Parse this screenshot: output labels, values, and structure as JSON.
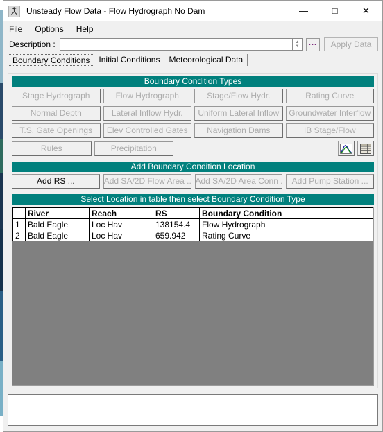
{
  "window": {
    "title": "Unsteady Flow Data - Flow Hydrograph No Dam",
    "app_icon": "hecras-icon",
    "controls": {
      "minimize": "—",
      "maximize": "□",
      "close": "✕"
    }
  },
  "menu": {
    "items": [
      {
        "label": "File",
        "mnemonic": "F"
      },
      {
        "label": "Options",
        "mnemonic": "O"
      },
      {
        "label": "Help",
        "mnemonic": "H"
      }
    ]
  },
  "description": {
    "label": "Description :",
    "value": "",
    "placeholder": "",
    "browse_label": "...",
    "apply_label": "Apply Data",
    "apply_enabled": false
  },
  "tabs": [
    {
      "label": "Boundary Conditions",
      "active": true
    },
    {
      "label": "Initial Conditions",
      "active": false
    },
    {
      "label": "Meteorological Data",
      "active": false
    }
  ],
  "bc_types": {
    "header": "Boundary Condition Types",
    "rows": [
      [
        {
          "label": "Stage Hydrograph",
          "enabled": false
        },
        {
          "label": "Flow Hydrograph",
          "enabled": false
        },
        {
          "label": "Stage/Flow Hydr.",
          "enabled": false
        },
        {
          "label": "Rating Curve",
          "enabled": false
        }
      ],
      [
        {
          "label": "Normal Depth",
          "enabled": false
        },
        {
          "label": "Lateral Inflow Hydr.",
          "enabled": false
        },
        {
          "label": "Uniform Lateral Inflow",
          "enabled": false
        },
        {
          "label": "Groundwater Interflow",
          "enabled": false
        }
      ],
      [
        {
          "label": "T.S. Gate Openings",
          "enabled": false
        },
        {
          "label": "Elev Controlled Gates",
          "enabled": false
        },
        {
          "label": "Navigation Dams",
          "enabled": false
        },
        {
          "label": "IB Stage/Flow",
          "enabled": false
        }
      ],
      [
        {
          "label": "Rules",
          "enabled": false
        },
        {
          "label": "Precipitation",
          "enabled": false
        }
      ]
    ],
    "icons": [
      {
        "name": "plot-hydrograph-icon"
      },
      {
        "name": "table-grid-icon"
      }
    ]
  },
  "add_location": {
    "header": "Add Boundary Condition Location",
    "buttons": [
      {
        "label": "Add RS ...",
        "enabled": true
      },
      {
        "label": "Add SA/2D Flow Area ...",
        "enabled": false
      },
      {
        "label": "Add SA/2D Area Conn ...",
        "enabled": false
      },
      {
        "label": "Add Pump Station ...",
        "enabled": false
      }
    ]
  },
  "table": {
    "header": "Select Location in table then select Boundary Condition Type",
    "columns": [
      "",
      "River",
      "Reach",
      "RS",
      "Boundary Condition"
    ],
    "rows": [
      {
        "num": "1",
        "river": "Bald Eagle",
        "reach": "Loc Hav",
        "rs": "138154.4",
        "bc": "Flow Hydrograph"
      },
      {
        "num": "2",
        "river": "Bald Eagle",
        "reach": "Loc Hav",
        "rs": "659.942",
        "bc": "Rating Curve"
      }
    ]
  },
  "message_panel": {
    "text": ""
  },
  "colors": {
    "section_header_bg": "#01807d",
    "section_header_fg": "#ffffff",
    "window_bg": "#f0f0f0",
    "table_empty_bg": "#808080",
    "disabled_text": "#acacac"
  }
}
